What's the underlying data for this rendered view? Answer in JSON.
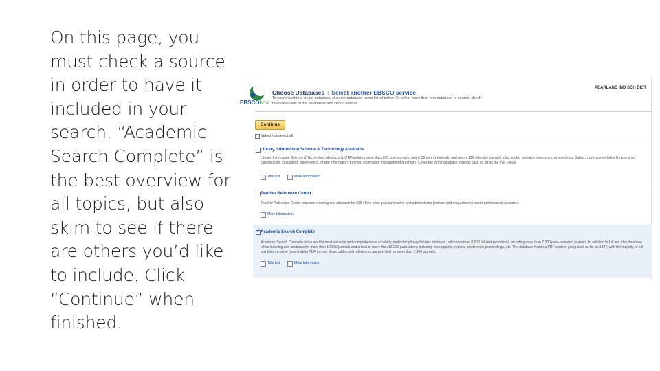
{
  "slide": {
    "lines": [
      "On this page, you",
      "must check a source",
      "in order to have it",
      "included in your",
      "search. “Academic",
      "Search Complete” is",
      "the best overview for",
      "all topics, but also",
      "skim to see if there",
      "are others you’d like",
      "to include. Click",
      "“Continue” when",
      "finished."
    ]
  },
  "screenshot": {
    "logo_text": "EBSCO",
    "logo_text_suffix": "host",
    "header_title": "Choose Databases",
    "header_separator": "|",
    "header_alt_link": "Select another EBSCO service",
    "instructions": "To search within a single database, click the database name listed below. To select more than one database to search, check the boxes next to the databases and click Continue.",
    "school": "PEARLAND IND SCH DIST",
    "continue_label": "Continue",
    "select_all_label": "Select / deselect all",
    "databases": [
      {
        "title": "Library, Information Science & Technology Abstracts",
        "desc_name": "Library, Information Science & Technology Abstracts",
        "desc": " (LISTA) indexes more than 600 core journals, nearly 50 priority journals, and nearly 125 selective journals; plus books, research reports and proceedings. Subject coverage includes librarianship, classification, cataloging, bibliometrics, online information retrieval, information management and more. Coverage in the database extends back as far as the mid-1960s.",
        "checked": false,
        "links": [
          "Title List",
          "More Information"
        ]
      },
      {
        "title": "Teacher Reference Center",
        "desc_name": "Teacher Reference Center",
        "desc": " provides indexing and abstracts for 230 of the most popular teacher and administrator journals and magazines to assist professional educators.",
        "checked": false,
        "links": [
          "More Information"
        ]
      },
      {
        "title": "Academic Search Complete",
        "desc_name": "Academic Search Complete",
        "desc": " is the world's most valuable and comprehensive scholarly, multi-disciplinary full-text database, with more than 8,500 full-text periodicals, including more than 7,300 peer-reviewed journals. In addition to full text, this database offers indexing and abstracts for more than 12,500 journals and a total of more than 13,200 publications including monographs, reports, conference proceedings, etc. The database features PDF content going back as far as 1887, with the majority of full text titles in native (searchable) PDF format. Searchable cited references are provided for more than 1,400 journals.",
        "checked": true,
        "links": [
          "Title List",
          "More Information"
        ]
      }
    ]
  },
  "colors": {
    "link_blue": "#1f4e9c",
    "ebsco_green": "#2d8a43",
    "continue_gold": "#f1c34e",
    "selected_row": "#e9f0f8"
  }
}
